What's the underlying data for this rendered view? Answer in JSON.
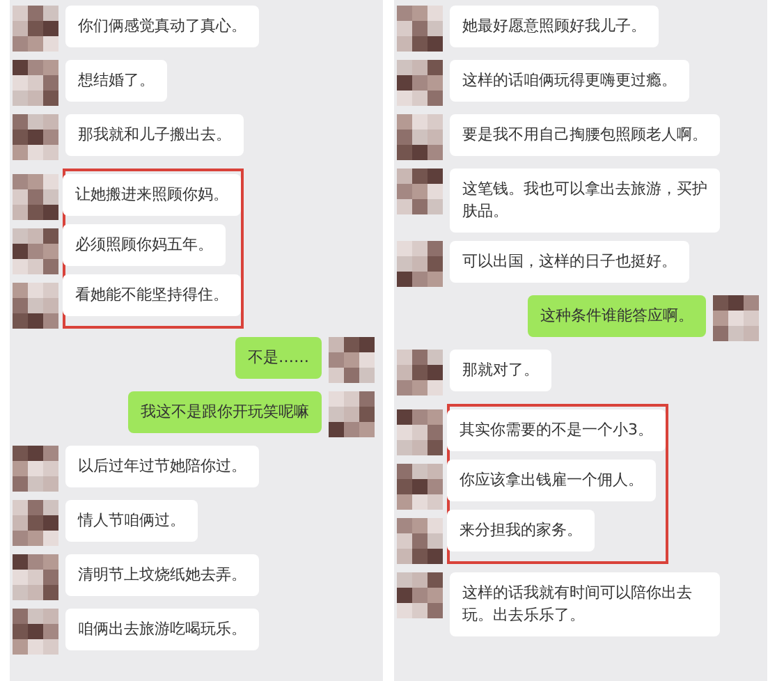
{
  "panels": [
    {
      "messages": [
        {
          "kind": "received",
          "text": "你们俩感觉真动了真心。",
          "highlighted": false
        },
        {
          "kind": "received",
          "text": "想结婚了。",
          "highlighted": false
        },
        {
          "kind": "received",
          "text": "那我就和儿子搬出去。",
          "highlighted": false
        },
        {
          "kind": "received",
          "text": "让她搬进来照顾你妈。",
          "highlighted": true
        },
        {
          "kind": "received",
          "text": "必须照顾你妈五年。",
          "highlighted": true
        },
        {
          "kind": "received",
          "text": "看她能不能坚持得住。",
          "highlighted": true
        },
        {
          "kind": "sent",
          "text": "不是……",
          "highlighted": false
        },
        {
          "kind": "sent",
          "text": "我这不是跟你开玩笑呢嘛",
          "highlighted": false
        },
        {
          "kind": "received",
          "text": "以后过年过节她陪你过。",
          "highlighted": false
        },
        {
          "kind": "received",
          "text": "情人节咱俩过。",
          "highlighted": false
        },
        {
          "kind": "received",
          "text": "清明节上坟烧纸她去弄。",
          "highlighted": false
        },
        {
          "kind": "received",
          "text": "咱俩出去旅游吃喝玩乐。",
          "highlighted": false
        }
      ]
    },
    {
      "messages": [
        {
          "kind": "received",
          "text": "她最好愿意照顾好我儿子。",
          "highlighted": false
        },
        {
          "kind": "received",
          "text": "这样的话咱俩玩得更嗨更过瘾。",
          "highlighted": false
        },
        {
          "kind": "received",
          "text": "要是我不用自己掏腰包照顾老人啊。",
          "highlighted": false
        },
        {
          "kind": "received",
          "text": "这笔钱。我也可以拿出去旅游，买护肤品。",
          "highlighted": false
        },
        {
          "kind": "received",
          "text": "可以出国，这样的日子也挺好。",
          "highlighted": false
        },
        {
          "kind": "sent",
          "text": "这种条件谁能答应啊。",
          "highlighted": false
        },
        {
          "kind": "received",
          "text": "那就对了。",
          "highlighted": false
        },
        {
          "kind": "received",
          "text": "其实你需要的不是一个小3。",
          "highlighted": true
        },
        {
          "kind": "received",
          "text": "你应该拿出钱雇一个佣人。",
          "highlighted": true
        },
        {
          "kind": "received",
          "text": "来分担我的家务。",
          "highlighted": true
        },
        {
          "kind": "received",
          "text": "这样的话我就有时间可以陪你出去玩。出去乐乐了。",
          "highlighted": false
        }
      ]
    }
  ]
}
